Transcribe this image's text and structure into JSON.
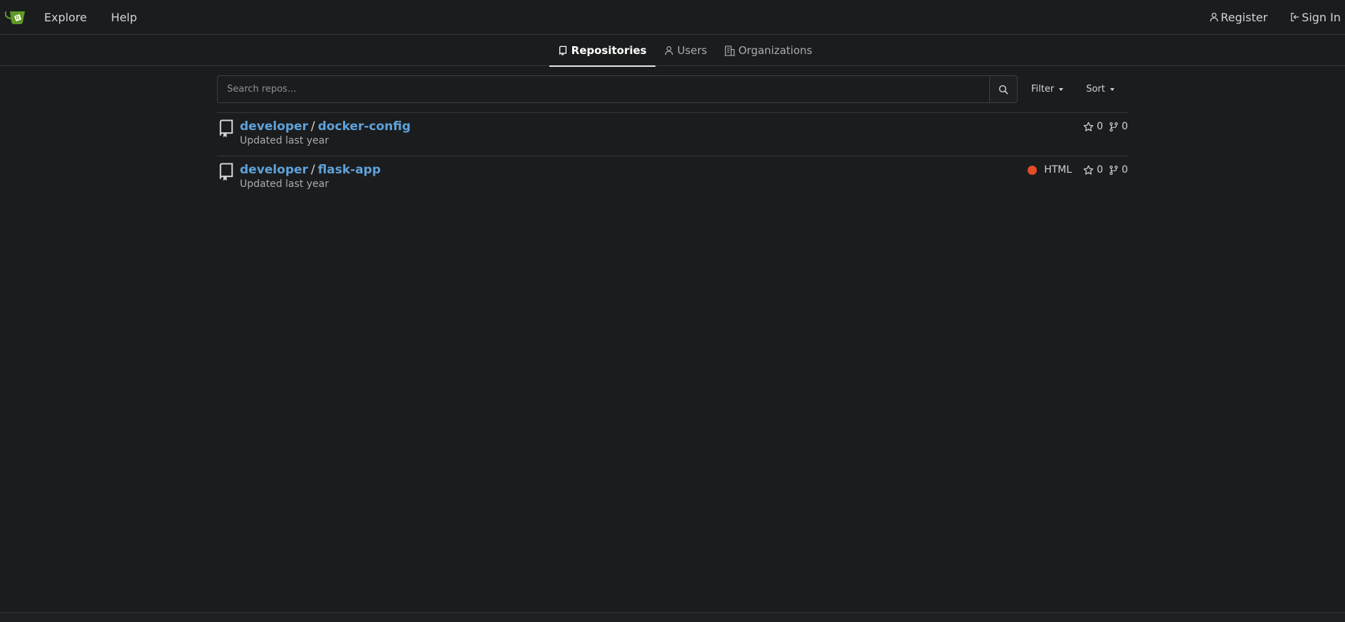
{
  "theme": {
    "link_color": "#5ea2da",
    "brand_green": "#609926",
    "html_lang_color": "#e34c26"
  },
  "navbar": {
    "logo_icon": "gitea-teacup-icon",
    "links": [
      {
        "label": "Explore"
      },
      {
        "label": "Help"
      }
    ],
    "register_label": "Register",
    "signin_label": "Sign In"
  },
  "tabs": [
    {
      "label": "Repositories",
      "icon": "repo-icon",
      "active": true
    },
    {
      "label": "Users",
      "icon": "person-icon",
      "active": false
    },
    {
      "label": "Organizations",
      "icon": "organization-icon",
      "active": false
    }
  ],
  "search": {
    "placeholder": "Search repos...",
    "value": "",
    "filter_label": "Filter",
    "sort_label": "Sort"
  },
  "repos": [
    {
      "owner": "developer",
      "name": "docker-config",
      "updated": "Updated last year",
      "language": "",
      "stars": "0",
      "forks": "0"
    },
    {
      "owner": "developer",
      "name": "flask-app",
      "updated": "Updated last year",
      "language": "HTML",
      "stars": "0",
      "forks": "0"
    }
  ]
}
